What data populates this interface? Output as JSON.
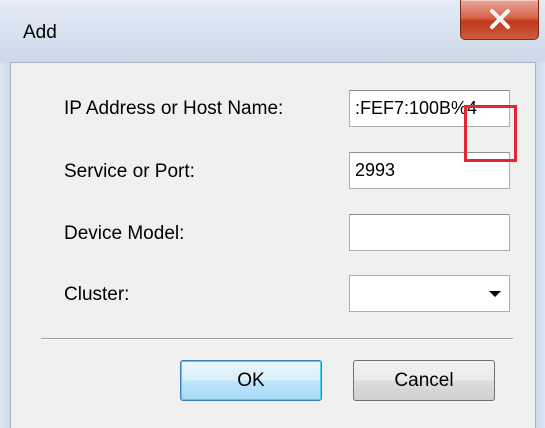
{
  "window": {
    "title": "Add",
    "close_glyph": "X"
  },
  "form": {
    "ip": {
      "label": "IP Address or Host Name:",
      "value": ":FEF7:100B%4"
    },
    "service": {
      "label": "Service or Port:",
      "value": "2993"
    },
    "device_model": {
      "label": "Device Model:",
      "value": ""
    },
    "cluster": {
      "label": "Cluster:",
      "selected": ""
    }
  },
  "buttons": {
    "ok_label": "OK",
    "cancel_label": "Cancel"
  },
  "annotation": {
    "highlight_color": "#e32636"
  },
  "icons": {
    "close": "close-icon",
    "dropdown": "chevron-down-icon"
  }
}
